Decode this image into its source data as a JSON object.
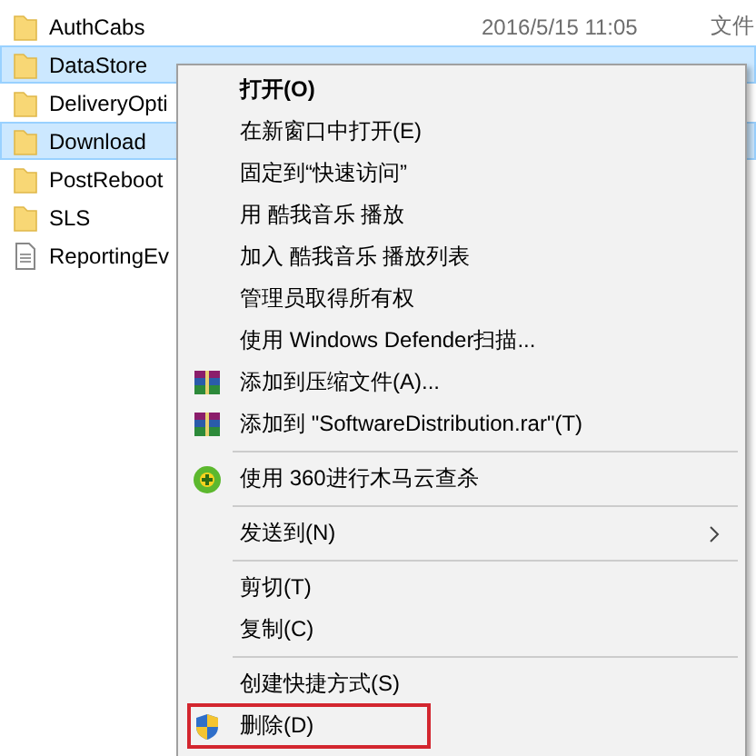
{
  "files": [
    {
      "name": "AuthCabs",
      "kind": "folder",
      "selected": false,
      "date": "2016/5/15 11:05",
      "type": "文件"
    },
    {
      "name": "DataStore",
      "kind": "folder",
      "selected": true
    },
    {
      "name": "DeliveryOpti",
      "kind": "folder",
      "selected": false
    },
    {
      "name": "Download",
      "kind": "folder",
      "selected": true
    },
    {
      "name": "PostReboot",
      "kind": "folder",
      "selected": false
    },
    {
      "name": "SLS",
      "kind": "folder",
      "selected": false
    },
    {
      "name": "ReportingEv",
      "kind": "file",
      "selected": false
    }
  ],
  "context_menu": {
    "groups": [
      [
        {
          "label": "打开(O)",
          "kind": "plain",
          "bold": true
        },
        {
          "label": "在新窗口中打开(E)",
          "kind": "plain"
        },
        {
          "label": "固定到“快速访问”",
          "kind": "plain"
        },
        {
          "label": "用 酷我音乐 播放",
          "kind": "plain"
        },
        {
          "label": "加入 酷我音乐 播放列表",
          "kind": "plain"
        },
        {
          "label": "管理员取得所有权",
          "kind": "plain"
        },
        {
          "label": "使用 Windows Defender扫描...",
          "kind": "plain"
        },
        {
          "label": "添加到压缩文件(A)...",
          "kind": "archive"
        },
        {
          "label": "添加到 \"SoftwareDistribution.rar\"(T)",
          "kind": "archive"
        }
      ],
      [
        {
          "label": "使用 360进行木马云查杀",
          "kind": "antivirus"
        }
      ],
      [
        {
          "label": "发送到(N)",
          "kind": "plain",
          "submenu": true
        }
      ],
      [
        {
          "label": "剪切(T)",
          "kind": "plain"
        },
        {
          "label": "复制(C)",
          "kind": "plain"
        }
      ],
      [
        {
          "label": "创建快捷方式(S)",
          "kind": "plain"
        },
        {
          "label": "删除(D)",
          "kind": "shield",
          "highlighted": true
        }
      ]
    ]
  }
}
